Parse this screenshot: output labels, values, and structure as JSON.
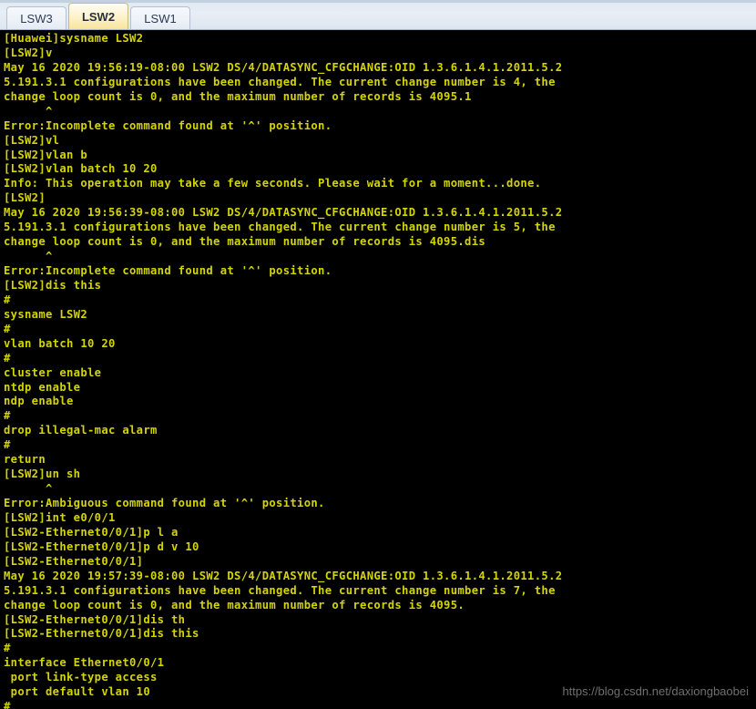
{
  "window": {
    "title": "LSW2"
  },
  "tabs": [
    {
      "label": "LSW3",
      "active": false
    },
    {
      "label": "LSW2",
      "active": true
    },
    {
      "label": "LSW1",
      "active": false
    }
  ],
  "terminal": {
    "foreground": "#d4d400",
    "background": "#000000",
    "lines": [
      "[Huawei]sysname LSW2",
      "[LSW2]v",
      "May 16 2020 19:56:19-08:00 LSW2 DS/4/DATASYNC_CFGCHANGE:OID 1.3.6.1.4.1.2011.5.2",
      "5.191.3.1 configurations have been changed. The current change number is 4, the",
      "change loop count is 0, and the maximum number of records is 4095.1",
      "      ^",
      "Error:Incomplete command found at '^' position.",
      "[LSW2]vl",
      "[LSW2]vlan b",
      "[LSW2]vlan batch 10 20",
      "Info: This operation may take a few seconds. Please wait for a moment...done.",
      "[LSW2]",
      "May 16 2020 19:56:39-08:00 LSW2 DS/4/DATASYNC_CFGCHANGE:OID 1.3.6.1.4.1.2011.5.2",
      "5.191.3.1 configurations have been changed. The current change number is 5, the",
      "change loop count is 0, and the maximum number of records is 4095.dis",
      "      ^",
      "Error:Incomplete command found at '^' position.",
      "[LSW2]dis this",
      "#",
      "sysname LSW2",
      "#",
      "vlan batch 10 20",
      "#",
      "cluster enable",
      "ntdp enable",
      "ndp enable",
      "#",
      "drop illegal-mac alarm",
      "#",
      "return",
      "[LSW2]un sh",
      "      ^",
      "Error:Ambiguous command found at '^' position.",
      "[LSW2]int e0/0/1",
      "[LSW2-Ethernet0/0/1]p l a",
      "[LSW2-Ethernet0/0/1]p d v 10",
      "[LSW2-Ethernet0/0/1]",
      "May 16 2020 19:57:39-08:00 LSW2 DS/4/DATASYNC_CFGCHANGE:OID 1.3.6.1.4.1.2011.5.2",
      "5.191.3.1 configurations have been changed. The current change number is 7, the",
      "change loop count is 0, and the maximum number of records is 4095.",
      "[LSW2-Ethernet0/0/1]dis th",
      "[LSW2-Ethernet0/0/1]dis this",
      "#",
      "interface Ethernet0/0/1",
      " port link-type access",
      " port default vlan 10",
      "#"
    ]
  },
  "watermark": {
    "text": "https://blog.csdn.net/daxiongbaobei"
  }
}
